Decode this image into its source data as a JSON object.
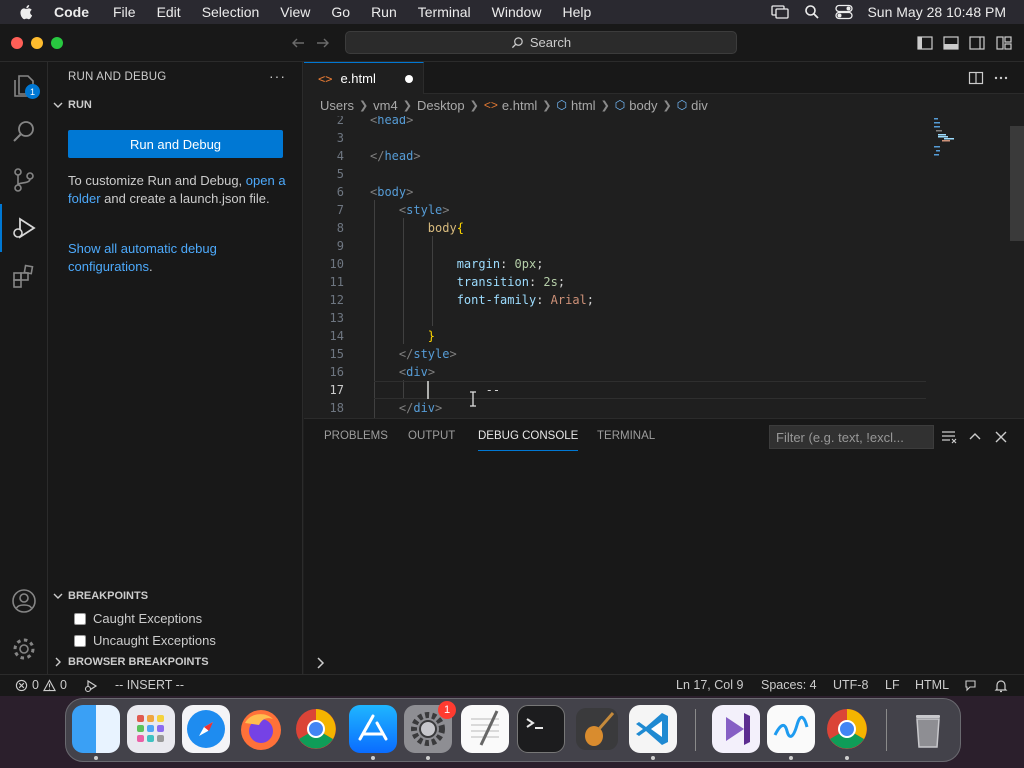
{
  "menubar": {
    "items": [
      "Code",
      "File",
      "Edit",
      "Selection",
      "View",
      "Go",
      "Run",
      "Terminal",
      "Window",
      "Help"
    ],
    "clock": "Sun May 28  10:48 PM"
  },
  "titlebar": {
    "search_label": "Search"
  },
  "activitybar": {
    "explorer_badge": "1"
  },
  "sidebar": {
    "title": "RUN AND DEBUG",
    "more": "···",
    "run_section": "RUN",
    "run_button": "Run and Debug",
    "customize_pre": "To customize Run and Debug, ",
    "customize_link": "open a folder",
    "customize_post": " and create a launch.json file.",
    "show_all_link": "Show all automatic debug configurations",
    "show_all_post": ".",
    "breakpoints_section": "BREAKPOINTS",
    "caught_exceptions": "Caught Exceptions",
    "uncaught_exceptions": "Uncaught Exceptions",
    "browser_breakpoints_section": "BROWSER BREAKPOINTS"
  },
  "tabs": [
    {
      "label": "e.html",
      "modified": true
    }
  ],
  "breadcrumb": [
    "Users",
    "vm4",
    "Desktop",
    "e.html",
    "html",
    "body",
    "div"
  ],
  "editor": {
    "lines": [
      {
        "n": "2",
        "html": "<span class='tag'>&lt;</span><span class='tname'>head</span><span class='tag'>&gt;</span>",
        "indent": 0
      },
      {
        "n": "3",
        "html": "",
        "indent": 0
      },
      {
        "n": "4",
        "html": "<span class='tag'>&lt;/</span><span class='tname'>head</span><span class='tag'>&gt;</span>",
        "indent": 0
      },
      {
        "n": "5",
        "html": "",
        "indent": 0
      },
      {
        "n": "6",
        "html": "<span class='tag'>&lt;</span><span class='tname'>body</span><span class='tag'>&gt;</span>",
        "indent": 0
      },
      {
        "n": "7",
        "html": "    <span class='tag'>&lt;</span><span class='tname'>style</span><span class='tag'>&gt;</span>",
        "indent": 0
      },
      {
        "n": "8",
        "html": "        <span class='sel'>body</span><span class='brace'>{</span>",
        "indent": 0
      },
      {
        "n": "9",
        "html": "",
        "indent": 0
      },
      {
        "n": "10",
        "html": "            <span class='prop'>margin</span><span class='punc'>: </span><span class='num'>0px</span><span class='punc'>;</span>",
        "indent": 0
      },
      {
        "n": "11",
        "html": "            <span class='prop'>transition</span><span class='punc'>: </span><span class='num'>2s</span><span class='punc'>;</span>",
        "indent": 0
      },
      {
        "n": "12",
        "html": "            <span class='prop'>font-family</span><span class='punc'>: </span><span class='val'>Arial</span><span class='punc'>;</span>",
        "indent": 0
      },
      {
        "n": "13",
        "html": "",
        "indent": 0
      },
      {
        "n": "14",
        "html": "        <span class='brace'>}</span>",
        "indent": 0
      },
      {
        "n": "15",
        "html": "    <span class='tag'>&lt;/</span><span class='tname'>style</span><span class='tag'>&gt;</span>",
        "indent": 0
      },
      {
        "n": "16",
        "html": "    <span class='tag'>&lt;</span><span class='tname'>div</span><span class='tag'>&gt;</span>",
        "indent": 0
      },
      {
        "n": "17",
        "html": "                <span class='punc'>--</span>",
        "indent": 0
      },
      {
        "n": "18",
        "html": "    <span class='tag'>&lt;/</span><span class='tname'>div</span><span class='tag'>&gt;</span>",
        "indent": 0
      }
    ],
    "current_line": "17"
  },
  "panel": {
    "tabs": [
      "PROBLEMS",
      "OUTPUT",
      "DEBUG CONSOLE",
      "TERMINAL"
    ],
    "active_tab": "DEBUG CONSOLE",
    "filter_placeholder": "Filter (e.g. text, !excl..."
  },
  "statusbar": {
    "errors": "0",
    "warnings": "0",
    "mode": "-- INSERT --",
    "position": "Ln 17, Col 9",
    "spaces": "Spaces: 4",
    "encoding": "UTF-8",
    "eol": "LF",
    "language": "HTML"
  },
  "dock": {
    "apps": [
      "finder",
      "launchpad",
      "safari",
      "firefox",
      "chrome",
      "app-store",
      "system-settings",
      "textedit",
      "terminal",
      "instruments",
      "vscode",
      "visual-studio",
      "freeform",
      "chrome",
      "trash"
    ],
    "settings_badge": "1"
  },
  "colors": {
    "accent": "#0078d4",
    "link": "#4daafc",
    "editor_bg": "#1f1f1f",
    "sidebar_bg": "#181818"
  }
}
